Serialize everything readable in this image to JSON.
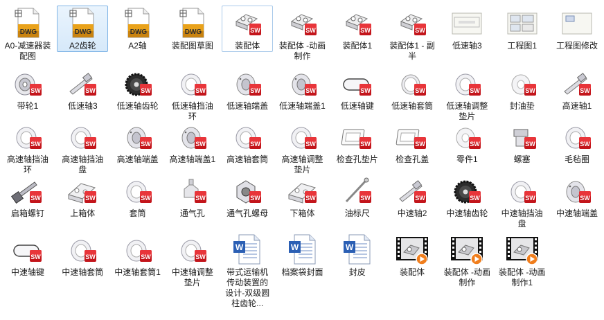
{
  "items": [
    {
      "label": "A0-减速器装配图",
      "icon": "dwg-file-icon",
      "kind": "dwg"
    },
    {
      "label": "A2齿轮",
      "icon": "dwg-file-icon",
      "kind": "dwg",
      "selected": true
    },
    {
      "label": "A2轴",
      "icon": "dwg-file-icon",
      "kind": "dwg"
    },
    {
      "label": "装配图草图",
      "icon": "dwg-file-icon",
      "kind": "dwg"
    },
    {
      "label": "装配体",
      "icon": "solidworks-assembly-icon",
      "kind": "assembly",
      "hover": true
    },
    {
      "label": "装配体 -动画制作",
      "icon": "solidworks-assembly-icon",
      "kind": "assembly"
    },
    {
      "label": "装配体1",
      "icon": "solidworks-assembly-icon",
      "kind": "assembly"
    },
    {
      "label": "装配体1 - 副半",
      "icon": "solidworks-assembly-icon",
      "kind": "assembly"
    },
    {
      "label": "低速轴3",
      "icon": "drawing-thumbnail-icon",
      "kind": "drawing"
    },
    {
      "label": "工程图1",
      "icon": "drawing-thumbnail-icon",
      "kind": "drawing2"
    },
    {
      "label": "工程图修改",
      "icon": "drawing-thumbnail-icon",
      "kind": "drawing3"
    },
    {
      "label": "带轮1",
      "icon": "solidworks-part-icon",
      "kind": "pulley"
    },
    {
      "label": "低速轴3",
      "icon": "solidworks-part-icon",
      "kind": "shaft"
    },
    {
      "label": "低速轴齿轮",
      "icon": "solidworks-part-icon",
      "kind": "gear"
    },
    {
      "label": "低速轴挡油环",
      "icon": "solidworks-part-icon",
      "kind": "ring"
    },
    {
      "label": "低速轴端盖",
      "icon": "solidworks-part-icon",
      "kind": "cover"
    },
    {
      "label": "低速轴端盖1",
      "icon": "solidworks-part-icon",
      "kind": "cover"
    },
    {
      "label": "低速轴键",
      "icon": "solidworks-part-icon",
      "kind": "key"
    },
    {
      "label": "低速轴套筒",
      "icon": "solidworks-part-icon",
      "kind": "sleeve"
    },
    {
      "label": "低速轴调整垫片",
      "icon": "solidworks-part-icon",
      "kind": "ring"
    },
    {
      "label": "封油垫",
      "icon": "solidworks-part-icon",
      "kind": "washer"
    },
    {
      "label": "高速轴1",
      "icon": "solidworks-part-icon",
      "kind": "shaft"
    },
    {
      "label": "高速轴挡油环",
      "icon": "solidworks-part-icon",
      "kind": "ring"
    },
    {
      "label": "高速轴挡油盘",
      "icon": "solidworks-part-icon",
      "kind": "ring"
    },
    {
      "label": "高速轴端盖",
      "icon": "solidworks-part-icon",
      "kind": "cover"
    },
    {
      "label": "高速轴端盖1",
      "icon": "solidworks-part-icon",
      "kind": "cover"
    },
    {
      "label": "高速轴套筒",
      "icon": "solidworks-part-icon",
      "kind": "ring"
    },
    {
      "label": "高速轴调整垫片",
      "icon": "solidworks-part-icon",
      "kind": "ring"
    },
    {
      "label": "检查孔垫片",
      "icon": "solidworks-part-icon",
      "kind": "plate"
    },
    {
      "label": "检查孔盖",
      "icon": "solidworks-part-icon",
      "kind": "plate"
    },
    {
      "label": "零件1",
      "icon": "solidworks-part-icon",
      "kind": "washer"
    },
    {
      "label": "螺塞",
      "icon": "solidworks-part-icon",
      "kind": "plug"
    },
    {
      "label": "毛毡圈",
      "icon": "solidworks-part-icon",
      "kind": "ring"
    },
    {
      "label": "启箱螺钉",
      "icon": "solidworks-part-icon",
      "kind": "bolt"
    },
    {
      "label": "上箱体",
      "icon": "solidworks-part-icon",
      "kind": "housing"
    },
    {
      "label": "套筒",
      "icon": "solidworks-part-icon",
      "kind": "ring"
    },
    {
      "label": "通气孔",
      "icon": "solidworks-part-icon",
      "kind": "vent"
    },
    {
      "label": "通气孔螺母",
      "icon": "solidworks-part-icon",
      "kind": "nut"
    },
    {
      "label": "下箱体",
      "icon": "solidworks-part-icon",
      "kind": "housing"
    },
    {
      "label": "油标尺",
      "icon": "solidworks-part-icon",
      "kind": "dipstick"
    },
    {
      "label": "中速轴2",
      "icon": "solidworks-part-icon",
      "kind": "shaft"
    },
    {
      "label": "中速轴齿轮",
      "icon": "solidworks-part-icon",
      "kind": "gear"
    },
    {
      "label": "中速轴挡油盘",
      "icon": "solidworks-part-icon",
      "kind": "ring"
    },
    {
      "label": "中速轴端盖",
      "icon": "solidworks-part-icon",
      "kind": "cover"
    },
    {
      "label": "中速轴键",
      "icon": "solidworks-part-icon",
      "kind": "key"
    },
    {
      "label": "中速轴套筒",
      "icon": "solidworks-part-icon",
      "kind": "ring"
    },
    {
      "label": "中速轴套筒1",
      "icon": "solidworks-part-icon",
      "kind": "ring"
    },
    {
      "label": "中速轴调整垫片",
      "icon": "solidworks-part-icon",
      "kind": "ring"
    },
    {
      "label": "带式运输机传动装置的设计-双级圆柱齿轮...",
      "icon": "word-document-icon",
      "kind": "doc"
    },
    {
      "label": "档案袋封面",
      "icon": "word-document-icon",
      "kind": "doc"
    },
    {
      "label": "封皮",
      "icon": "word-document-icon",
      "kind": "doc"
    },
    {
      "label": "装配体",
      "icon": "video-file-icon",
      "kind": "video"
    },
    {
      "label": "装配体 -动画制作",
      "icon": "video-file-icon",
      "kind": "video"
    },
    {
      "label": "装配体 -动画制作1",
      "icon": "video-file-icon",
      "kind": "video"
    }
  ],
  "badges": {
    "sw": "SW",
    "dwg": "DWG",
    "word": "W"
  },
  "colors": {
    "selection": "#d6e9fa",
    "sw_red": "#d4161c",
    "dwg_gold": "#e9a21b",
    "word_blue": "#2b5fb4"
  }
}
